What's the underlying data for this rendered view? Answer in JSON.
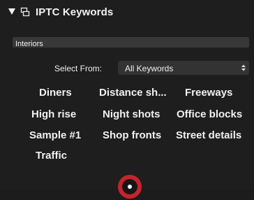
{
  "header": {
    "title": "IPTC Keywords",
    "disclosure_icon": "disclosure-triangle-down-icon",
    "keywords_icon": "keyword-tag-icon"
  },
  "keyword_field": {
    "value": "Interiors"
  },
  "select_from": {
    "label": "Select From:",
    "value": "All Keywords",
    "stepper_icon": "up-down-chevron-icon"
  },
  "keywords": [
    "Diners",
    "Distance sh...",
    "Freeways",
    "High rise",
    "Night shots",
    "Office blocks",
    "Sample #1",
    "Shop fronts",
    "Street details",
    "Traffic"
  ],
  "record_button_icon": "record-icon",
  "colors": {
    "background": "#1e1e1e",
    "field": "#383838",
    "select": "#333333",
    "record_red": "#c8232c"
  }
}
